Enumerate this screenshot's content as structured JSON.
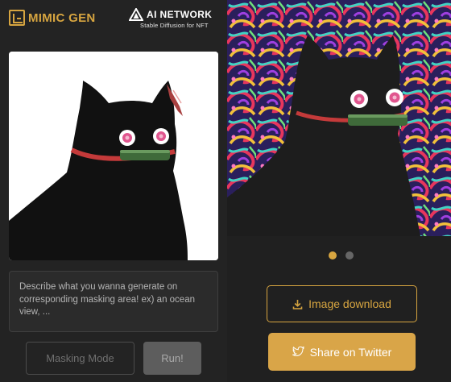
{
  "brand": {
    "name": "MIMIC GEN",
    "icon": "mimic-gen-logo-icon",
    "color": "#d7a540"
  },
  "partner": {
    "title": "AI NETWORK",
    "subtitle": "Stable Diffusion for NFT",
    "icon": "ai-network-logo-icon"
  },
  "editor": {
    "prompt_placeholder": "Describe what you wanna generate on corresponding masking area! ex) an ocean view, ...",
    "masking_mode_label": "Masking Mode",
    "run_label": "Run!"
  },
  "result": {
    "pagination": {
      "count": 2,
      "active_index": 0
    },
    "download_label": "Image download",
    "download_icon": "download-icon",
    "share_label": "Share on Twitter",
    "share_icon": "twitter-icon"
  },
  "colors": {
    "accent": "#d7a540",
    "background": "#1b1b1b",
    "panel": "#232323"
  }
}
